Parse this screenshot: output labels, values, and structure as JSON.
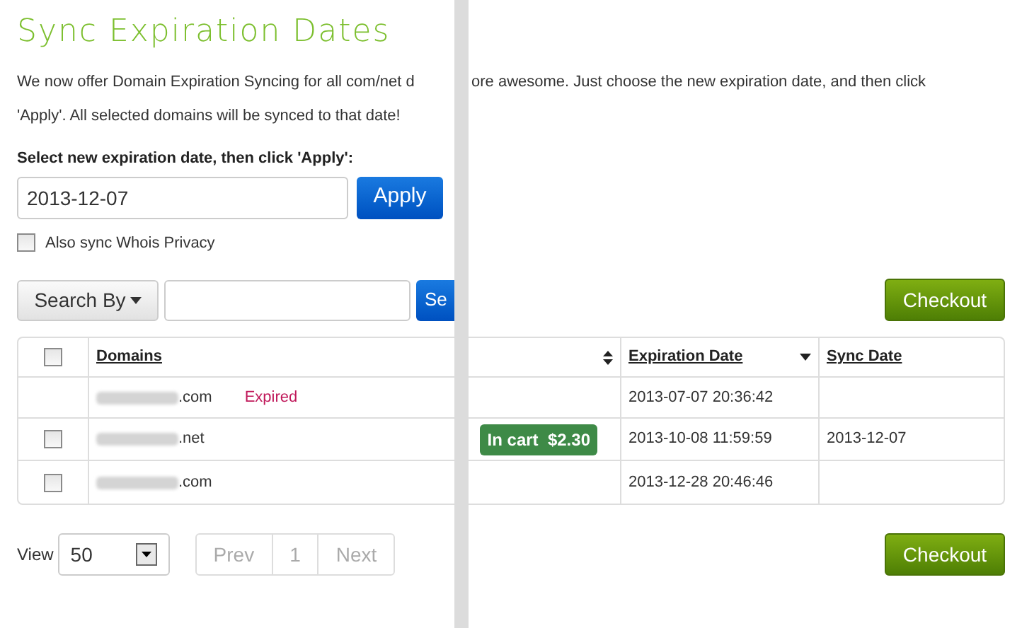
{
  "title": "Sync Expiration Dates",
  "intro": {
    "line1_left": "We now offer Domain Expiration Syncing for all com/net d",
    "line1_right": "ore awesome. Just choose the new expiration date, and then click",
    "line2": "'Apply'. All selected domains will be synced to that date!"
  },
  "date_form": {
    "label": "Select new expiration date, then click 'Apply':",
    "value": "2013-12-07",
    "apply": "Apply",
    "privacy": {
      "label": "Also sync Whois Privacy",
      "checked": false
    }
  },
  "search": {
    "by": "Search By",
    "button": "Se"
  },
  "checkout": [
    "Checkout",
    "Checkout"
  ],
  "table": {
    "select_all": {
      "checked": false
    },
    "columns": [
      "Domains",
      "Expiration Date",
      "Sync Date"
    ],
    "rows": [
      {
        "has_checkbox": false,
        "domain": ".com",
        "status": "Expired",
        "badge": null,
        "expiration": "2013-07-07 20:36:42",
        "sync": null
      },
      {
        "has_checkbox": true,
        "checked": false,
        "domain": ".net",
        "status": null,
        "badge": "In cart  $2.30",
        "expiration": "2013-10-08 11:59:59",
        "sync": "2013-12-07"
      },
      {
        "has_checkbox": true,
        "checked": false,
        "domain": ".com",
        "status": null,
        "badge": null,
        "expiration": "2013-12-28 20:46:46",
        "sync": null
      }
    ]
  },
  "view": {
    "label": "View",
    "value": "50"
  },
  "pager": [
    {
      "label": "Prev",
      "disabled": true
    },
    {
      "label": "1",
      "disabled": true
    },
    {
      "label": "Next",
      "disabled": true
    }
  ]
}
